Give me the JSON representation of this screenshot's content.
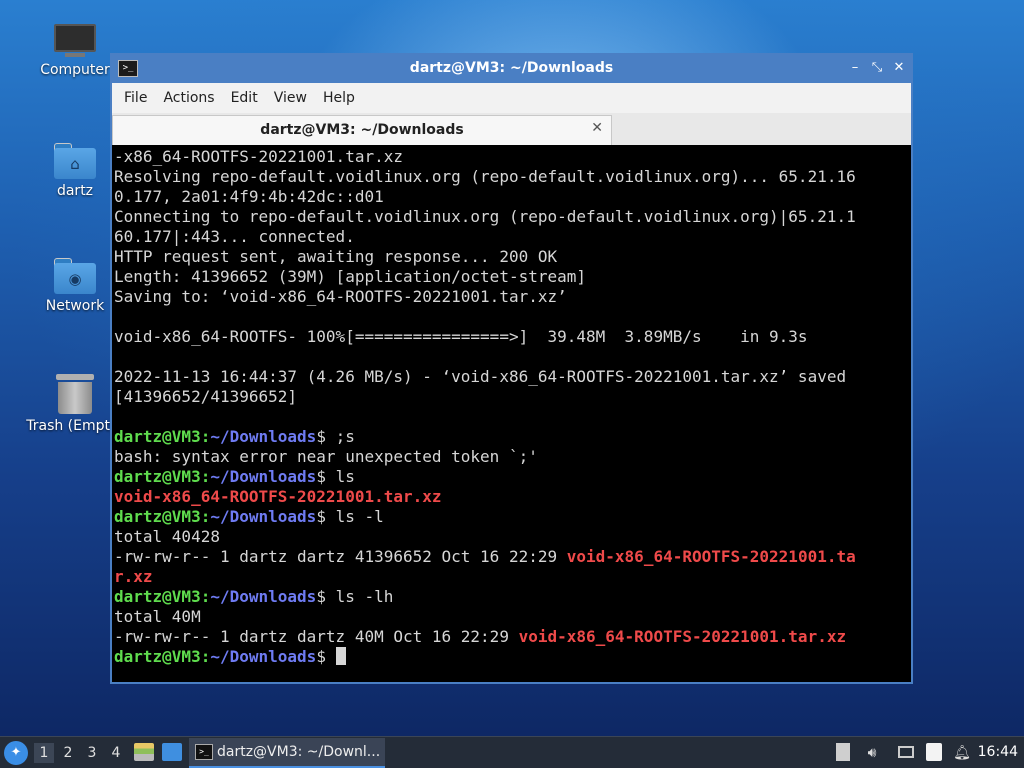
{
  "desktop": {
    "icons": [
      {
        "label": "Computer",
        "icon": "computer-icon"
      },
      {
        "label": "dartz",
        "icon": "home-folder-icon"
      },
      {
        "label": "Network",
        "icon": "network-folder-icon"
      },
      {
        "label": "Trash (Empty)",
        "icon": "trash-icon"
      }
    ]
  },
  "window": {
    "title": "dartz@VM3: ~/Downloads",
    "controls": {
      "minimize": "–",
      "maximize": "⤡",
      "close": "✕"
    },
    "menu": [
      "File",
      "Actions",
      "Edit",
      "View",
      "Help"
    ],
    "tab": {
      "label": "dartz@VM3: ~/Downloads",
      "close": "✕"
    }
  },
  "terminal": {
    "user": "dartz@VM3",
    "colon": ":",
    "path": "~/Downloads",
    "dollar": "$ ",
    "lines": [
      "-x86_64-ROOTFS-20221001.tar.xz",
      "Resolving repo-default.voidlinux.org (repo-default.voidlinux.org)... 65.21.16",
      "0.177, 2a01:4f9:4b:42dc::d01",
      "Connecting to repo-default.voidlinux.org (repo-default.voidlinux.org)|65.21.1",
      "60.177|:443... connected.",
      "HTTP request sent, awaiting response... 200 OK",
      "Length: 41396652 (39M) [application/octet-stream]",
      "Saving to: ‘void-x86_64-ROOTFS-20221001.tar.xz’",
      "",
      "void-x86_64-ROOTFS- 100%[================>]  39.48M  3.89MB/s    in 9.3s",
      "",
      "2022-11-13 16:44:37 (4.26 MB/s) - ‘void-x86_64-ROOTFS-20221001.tar.xz’ saved",
      "[41396652/41396652]",
      ""
    ],
    "cmd1": ";s",
    "err1": "bash: syntax error near unexpected token `;'",
    "cmd2": "ls",
    "file_name": "void-x86_64-ROOTFS-20221001.tar.xz",
    "cmd3": "ls -l",
    "total1": "total 40428",
    "ll_prefix": "-rw-rw-r-- 1 dartz dartz 41396652 Oct 16 22:29 ",
    "ll_file_part1": "void-x86_64-ROOTFS-20221001.ta",
    "ll_file_part2": "r.xz",
    "cmd4": "ls -lh",
    "total2": "total 40M",
    "lh_prefix": "-rw-rw-r-- 1 dartz dartz 40M Oct 16 22:29 "
  },
  "panel": {
    "workspaces": [
      "1",
      "2",
      "3",
      "4"
    ],
    "active_workspace": "1",
    "task_label": "dartz@VM3: ~/Downl...",
    "clock": "16:44"
  },
  "colors": {
    "prompt_user": "#5fdc4e",
    "prompt_path": "#6e7bf2",
    "archive_file": "#ef4a4a",
    "window_border": "#4a7fc4"
  }
}
